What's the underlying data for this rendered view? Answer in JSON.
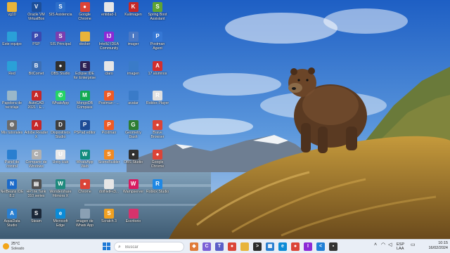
{
  "colors": {
    "taskbar": "#e9eef6",
    "accent": "#1e79d6",
    "sky": "#2a6fd0"
  },
  "desktop_icons": [
    {
      "label": "vg10",
      "icon": "folder-icon",
      "color": "#e8b43a",
      "glyph": ""
    },
    {
      "label": "Oracle VM VirtualBox",
      "icon": "virtualbox-icon",
      "color": "#1d4f9a",
      "glyph": "V"
    },
    {
      "label": "SIS Asistencia",
      "icon": "app-icon",
      "color": "#2c6ec9",
      "glyph": "S"
    },
    {
      "label": "Google Chrome",
      "icon": "chrome-icon",
      "color": "#db4437",
      "glyph": "●"
    },
    {
      "label": "entidad-1",
      "icon": "document-icon",
      "color": "#e6e6e6",
      "glyph": ""
    },
    {
      "label": "Kalimagen",
      "icon": "app-icon",
      "color": "#c62828",
      "glyph": "K"
    },
    {
      "label": "Spring Boot Assistant",
      "icon": "spring-icon",
      "color": "#5fa332",
      "glyph": "S"
    },
    {
      "label": "Este equipo",
      "icon": "computer-icon",
      "color": "#2aa0d8",
      "glyph": ""
    },
    {
      "label": "PSP",
      "icon": "app-icon",
      "color": "#3a4ab0",
      "glyph": "P"
    },
    {
      "label": "SIS Principal",
      "icon": "app-icon",
      "color": "#7a3fb0",
      "glyph": "S"
    },
    {
      "label": "docker",
      "icon": "folder-icon",
      "color": "#e8b43a",
      "glyph": ""
    },
    {
      "label": "IntelliJ IDEA Community",
      "icon": "intellij-icon",
      "color": "#8c2ad6",
      "glyph": "IJ"
    },
    {
      "label": "imager",
      "icon": "imager-icon",
      "color": "#4a78c4",
      "glyph": "I"
    },
    {
      "label": "Postman Agent",
      "icon": "postman-icon",
      "color": "#3577d4",
      "glyph": "P"
    },
    {
      "label": "Red",
      "icon": "network-icon",
      "color": "#2aa0d8",
      "glyph": ""
    },
    {
      "label": "BitComet",
      "icon": "bitcomet-icon",
      "color": "#3d6fb4",
      "glyph": "B"
    },
    {
      "label": "OBS Studio",
      "icon": "obs-icon",
      "color": "#303030",
      "glyph": "●"
    },
    {
      "label": "Eclipse IDE for Enterprise",
      "icon": "eclipse-icon",
      "color": "#2c2255",
      "glyph": "E"
    },
    {
      "label": "claro",
      "icon": "document-icon",
      "color": "#e6e6e6",
      "glyph": ""
    },
    {
      "label": "imagen",
      "icon": "image-icon",
      "color": "#3a7bc8",
      "glyph": ""
    },
    {
      "label": "17 alumnos",
      "icon": "pdf-icon",
      "color": "#d32f2f",
      "glyph": "A"
    },
    {
      "label": "Papelera de reciclaje",
      "icon": "recycle-bin-icon",
      "color": "#9ab7c9",
      "glyph": ""
    },
    {
      "label": "AutoCAD 2021 - E...",
      "icon": "autocad-icon",
      "color": "#c62828",
      "glyph": "A"
    },
    {
      "label": "WhatsApp",
      "icon": "whatsapp-icon",
      "color": "#25d366",
      "glyph": "✆"
    },
    {
      "label": "MongoDB Compass",
      "icon": "mongodb-icon",
      "color": "#13aa52",
      "glyph": "M"
    },
    {
      "label": "Postman - ...",
      "icon": "postman-icon",
      "color": "#ef5b25",
      "glyph": "P"
    },
    {
      "label": "avatar",
      "icon": "image-icon",
      "color": "#3a7bc8",
      "glyph": ""
    },
    {
      "label": "Roblox Player",
      "icon": "roblox-icon",
      "color": "#e0e0e0",
      "glyph": "R"
    },
    {
      "label": "Mis tutoriales",
      "icon": "tools-icon",
      "color": "#6b6b6b",
      "glyph": "⚙"
    },
    {
      "label": "Adobe Reader X",
      "icon": "adobe-icon",
      "color": "#c62828",
      "glyph": "A"
    },
    {
      "label": "Dispositivos Studio",
      "icon": "app-icon",
      "color": "#404040",
      "glyph": "D"
    },
    {
      "label": "PSPad editor",
      "icon": "pspad-icon",
      "color": "#1e4c96",
      "glyph": "P"
    },
    {
      "label": "Postman",
      "icon": "postman-icon",
      "color": "#ef5b25",
      "glyph": "P"
    },
    {
      "label": "Geometry Dash",
      "icon": "game-icon",
      "color": "#2e7d32",
      "glyph": "G"
    },
    {
      "label": "Brave Browser",
      "icon": "chrome-icon",
      "color": "#db4437",
      "glyph": "●"
    },
    {
      "label": "Panel de control",
      "icon": "control-panel-icon",
      "color": "#2a7fd0",
      "glyph": ""
    },
    {
      "label": "Compartir de Windows",
      "icon": "app-icon",
      "color": "#b0b0b0",
      "glyph": "C"
    },
    {
      "label": "Unity Hub",
      "icon": "unity-icon",
      "color": "#e8e8e8",
      "glyph": "U"
    },
    {
      "label": "WhatsApp Web",
      "icon": "whatsapp-icon",
      "color": "#128c7e",
      "glyph": "W"
    },
    {
      "label": "SceneBuilder",
      "icon": "scenebuilder-icon",
      "color": "#f08a24",
      "glyph": "S"
    },
    {
      "label": "OBS Studio",
      "icon": "obs-icon",
      "color": "#303030",
      "glyph": "●"
    },
    {
      "label": "Google Chrome",
      "icon": "chrome-icon",
      "color": "#db4437",
      "glyph": "●"
    },
    {
      "label": "NetBeans IDE 8.2",
      "icon": "netbeans-icon",
      "color": "#1b6ac9",
      "glyph": "N"
    },
    {
      "label": "HP Ink Tank 310 series",
      "icon": "printer-icon",
      "color": "#505050",
      "glyph": "▤"
    },
    {
      "label": "Wondershare Filmora X",
      "icon": "filmora-icon",
      "color": "#1f8a7e",
      "glyph": "W"
    },
    {
      "label": "Chrome",
      "icon": "chrome-icon",
      "color": "#db4437",
      "glyph": "●"
    },
    {
      "label": "dotNetFx3...",
      "icon": "document-icon",
      "color": "#e6e6e6",
      "glyph": ""
    },
    {
      "label": "Wampserver",
      "icon": "wampserver-icon",
      "color": "#d81b60",
      "glyph": "W"
    },
    {
      "label": "Roblox Studio",
      "icon": "roblox-icon",
      "color": "#1e88e5",
      "glyph": "R"
    },
    {
      "label": "AquaData Studio",
      "icon": "app-icon",
      "color": "#2a7fd0",
      "glyph": "A"
    },
    {
      "label": "Steam",
      "icon": "steam-icon",
      "color": "#1b2838",
      "glyph": "S"
    },
    {
      "label": "Microsoft Edge",
      "icon": "edge-icon",
      "color": "#0c8bd6",
      "glyph": "e"
    },
    {
      "label": "imagen de Whats App",
      "icon": "image-icon",
      "color": "#8aa0b4",
      "glyph": ""
    },
    {
      "label": "Scratch 3",
      "icon": "scratch-icon",
      "color": "#f0a020",
      "glyph": "S"
    },
    {
      "label": "Escritorio",
      "icon": "desktop-icon",
      "color": "#d6336c",
      "glyph": ""
    }
  ],
  "taskbar": {
    "weather": {
      "temperature": "25°C",
      "condition": "Soleado",
      "icon": "sun-icon"
    },
    "search_placeholder": "Buscar",
    "apps": [
      {
        "name": "widgets-icon",
        "color": "#e07b39",
        "glyph": "◆"
      },
      {
        "name": "copilot-icon",
        "color": "#7b5fd6",
        "glyph": "C"
      },
      {
        "name": "teams-icon",
        "color": "#5b5fc7",
        "glyph": "T"
      },
      {
        "name": "chrome-icon",
        "color": "#db4437",
        "glyph": "●"
      },
      {
        "name": "folder-icon",
        "color": "#e8b43a",
        "glyph": ""
      },
      {
        "name": "terminal-icon",
        "color": "#2b2b2b",
        "glyph": ">"
      },
      {
        "name": "store-icon",
        "color": "#2a7fd0",
        "glyph": "▦"
      },
      {
        "name": "edge-icon",
        "color": "#0c8bd6",
        "glyph": "e"
      },
      {
        "name": "chrome-icon",
        "color": "#db4437",
        "glyph": "●"
      },
      {
        "name": "intellij-icon",
        "color": "#8c2ad6",
        "glyph": "I"
      },
      {
        "name": "vscode-icon",
        "color": "#1f7fd6",
        "glyph": "<"
      },
      {
        "name": "app-icon",
        "color": "#333333",
        "glyph": "▪"
      }
    ],
    "tray": {
      "language_top": "ESP",
      "language_bottom": "LAA"
    },
    "clock": {
      "time": "10:15",
      "date": "16/02/2024"
    }
  }
}
